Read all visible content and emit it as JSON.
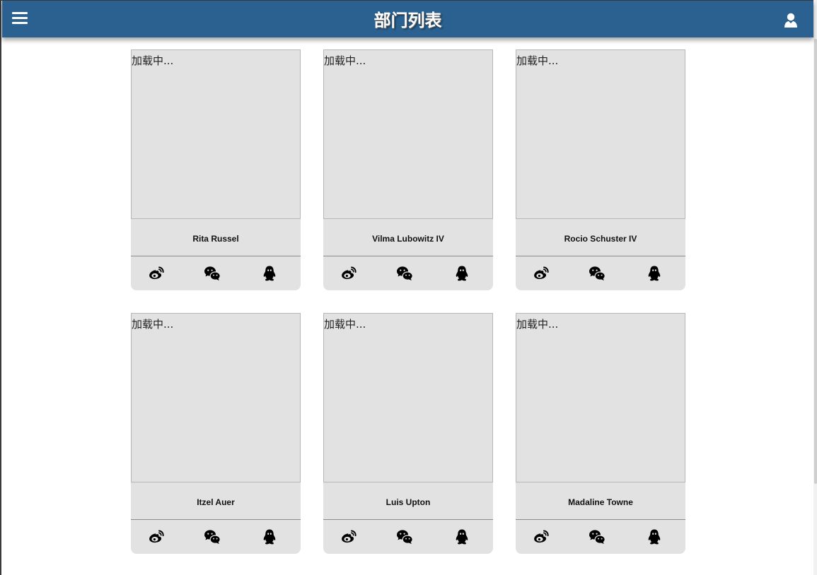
{
  "header": {
    "title": "部门列表",
    "menu_icon": "hamburger-menu-icon",
    "user_icon": "user-icon",
    "bg_color": "#2a6190"
  },
  "cards": [
    {
      "image_text": "加载中...",
      "name": "Rita Russel"
    },
    {
      "image_text": "加载中...",
      "name": "Vilma Lubowitz IV"
    },
    {
      "image_text": "加载中...",
      "name": "Rocio Schuster IV"
    },
    {
      "image_text": "加载中...",
      "name": "Itzel Auer"
    },
    {
      "image_text": "加载中...",
      "name": "Luis Upton"
    },
    {
      "image_text": "加载中...",
      "name": "Madaline Towne"
    }
  ],
  "social_icons": [
    "weibo-icon",
    "wechat-icon",
    "qq-icon"
  ]
}
